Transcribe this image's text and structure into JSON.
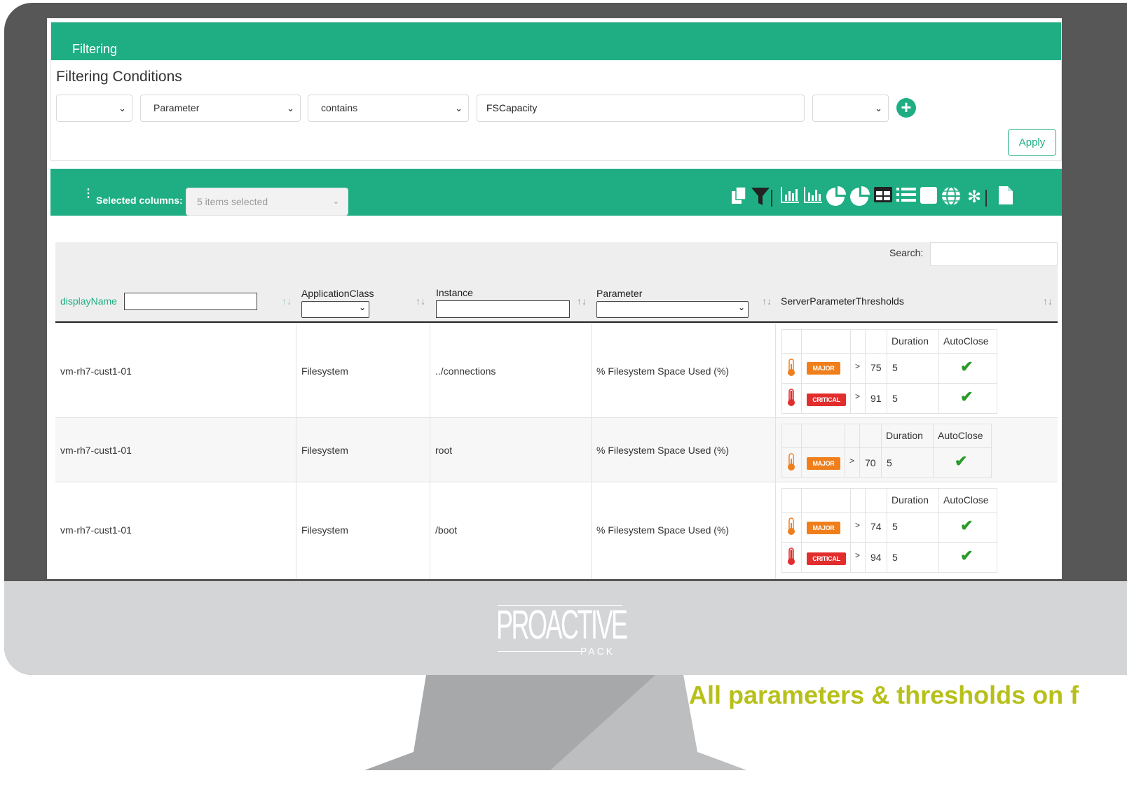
{
  "filtering": {
    "header": "Filtering",
    "conditions_title": "Filtering Conditions",
    "col_select": "Parameter",
    "op_select": "contains",
    "value": "FSCapacity",
    "apply": "Apply",
    "add_symbol": "+"
  },
  "columns_bar": {
    "label": "Selected columns:",
    "dropdown": "5 items selected",
    "menu_glyph": "⋮"
  },
  "search": {
    "label": "Search:"
  },
  "table": {
    "headers": [
      "displayName",
      "ApplicationClass",
      "Instance",
      "Parameter",
      "ServerParameterThresholds"
    ],
    "threshold_headers": [
      "Duration",
      "AutoClose"
    ],
    "rows": [
      {
        "displayName": "vm-rh7-cust1-01",
        "applicationClass": "Filesystem",
        "instance": "../connections",
        "parameter": "% Filesystem Space Used (%)",
        "thresholds": [
          {
            "severity": "MAJOR",
            "op": ">",
            "value": "75",
            "duration": "5",
            "autoclose": "✔"
          },
          {
            "severity": "CRITICAL",
            "op": ">",
            "value": "91",
            "duration": "5",
            "autoclose": "✔"
          }
        ]
      },
      {
        "displayName": "vm-rh7-cust1-01",
        "applicationClass": "Filesystem",
        "instance": "root",
        "parameter": "% Filesystem Space Used (%)",
        "thresholds": [
          {
            "severity": "MAJOR",
            "op": ">",
            "value": "70",
            "duration": "5",
            "autoclose": "✔"
          }
        ]
      },
      {
        "displayName": "vm-rh7-cust1-01",
        "applicationClass": "Filesystem",
        "instance": "/boot",
        "parameter": "% Filesystem Space Used (%)",
        "thresholds": [
          {
            "severity": "MAJOR",
            "op": ">",
            "value": "74",
            "duration": "5",
            "autoclose": "✔"
          },
          {
            "severity": "CRITICAL",
            "op": ">",
            "value": "94",
            "duration": "5",
            "autoclose": "✔"
          }
        ]
      }
    ]
  },
  "brand": {
    "logo": "PROACTIVE",
    "logo_sub": "PACK"
  },
  "caption": "All parameters & thresholds on f",
  "colors": {
    "accent": "#1fae83",
    "major": "#f07e1b",
    "critical": "#e22d2d",
    "caption": "#b7c01a"
  }
}
